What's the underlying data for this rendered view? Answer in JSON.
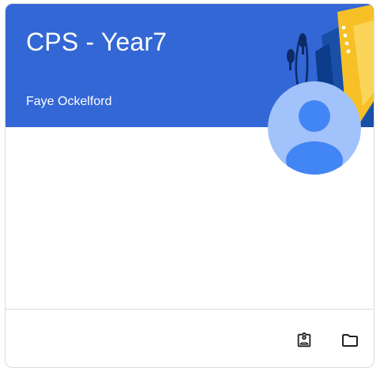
{
  "course": {
    "title": "CPS - Year7",
    "teacher": "Faye Ockelford"
  },
  "footer": {
    "icons": [
      "assignment-ind-icon",
      "folder-icon"
    ]
  },
  "colors": {
    "header": "#3367d6",
    "avatar_bg": "#a1c2fa",
    "avatar_fg": "#4285f4",
    "book": "#f6c026",
    "icon": "#202124"
  }
}
